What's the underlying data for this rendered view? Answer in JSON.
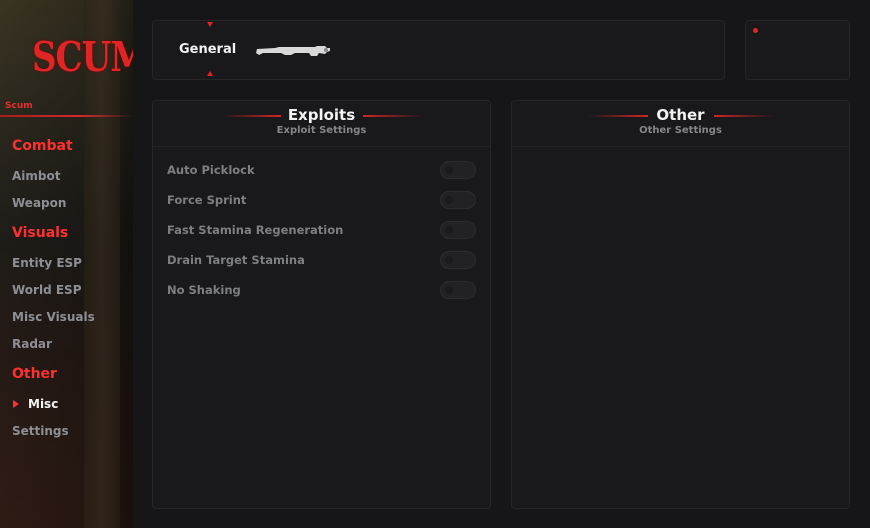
{
  "brand": {
    "logo_text": "SCUM",
    "name": "Scum"
  },
  "sidebar": {
    "groups": [
      {
        "label": "Combat",
        "items": [
          "Aimbot",
          "Weapon"
        ]
      },
      {
        "label": "Visuals",
        "items": [
          "Entity ESP",
          "World ESP",
          "Misc Visuals",
          "Radar"
        ]
      },
      {
        "label": "Other",
        "items": [
          "Misc",
          "Settings"
        ]
      }
    ],
    "active_item": "Misc"
  },
  "tabs": {
    "active": "General"
  },
  "sections": {
    "exploits": {
      "title": "Exploits",
      "subtitle": "Exploit Settings",
      "options": [
        {
          "label": "Auto Picklock",
          "enabled": false
        },
        {
          "label": "Force Sprint",
          "enabled": false
        },
        {
          "label": "Fast Stamina Regeneration",
          "enabled": false
        },
        {
          "label": "Drain Target Stamina",
          "enabled": false
        },
        {
          "label": "No Shaking",
          "enabled": false
        }
      ]
    },
    "other": {
      "title": "Other",
      "subtitle": "Other Settings"
    }
  },
  "colors": {
    "accent": "#e02525",
    "background": "#161618",
    "panel": "#19191b",
    "muted_text": "#7e7f84"
  },
  "icons": {
    "weapon": "rifle-icon",
    "indicator": "red-dot-indicator"
  }
}
